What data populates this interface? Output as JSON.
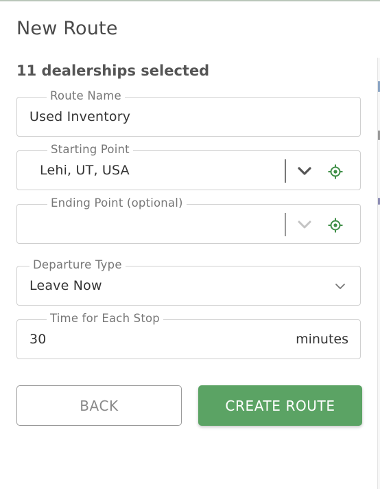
{
  "page": {
    "title": "New Route",
    "subtitle": "11 dealerships selected"
  },
  "form": {
    "route_name": {
      "label": "Route Name",
      "value": "Used Inventory"
    },
    "starting_point": {
      "label": "Starting Point",
      "value": "Lehi, UT, USA"
    },
    "ending_point": {
      "label": "Ending Point (optional)",
      "value": ""
    },
    "departure_type": {
      "label": "Departure Type",
      "value": "Leave Now"
    },
    "time_per_stop": {
      "label": "Time for Each Stop",
      "value": "30",
      "suffix": "minutes"
    }
  },
  "actions": {
    "back_label": "BACK",
    "create_label": "CREATE ROUTE"
  },
  "icons": {
    "dropdown": "chevron-down-icon",
    "locate": "crosshair-location-icon"
  },
  "colors": {
    "accent": "#5ba364",
    "locate_icon": "#3f8f47",
    "text": "#333333",
    "border": "#cfcfcf"
  }
}
